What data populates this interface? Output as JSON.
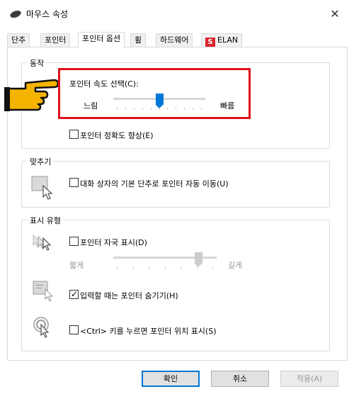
{
  "window": {
    "title": "마우스 속성",
    "close_label": "✕"
  },
  "tabs": [
    {
      "label": "단추"
    },
    {
      "label": "포인터"
    },
    {
      "label": "포인터 옵션",
      "active": true
    },
    {
      "label": "휠"
    },
    {
      "label": "하드웨어"
    },
    {
      "label": "ELAN"
    }
  ],
  "motion": {
    "group_label": "동작",
    "speed_label": "포인터 속도 선택(C):",
    "slow_label": "느림",
    "fast_label": "빠름",
    "speed_level": 0.5,
    "precision_label": "포인터 정확도 향상(E)",
    "precision_checked": false
  },
  "snap": {
    "group_label": "맞추기",
    "snap_label": "대화 상자의 기본 단추로 포인터 자동 이동(U)",
    "snap_checked": false
  },
  "visibility": {
    "group_label": "표시 유형",
    "trails_label": "포인터 자국 표시(D)",
    "trails_checked": false,
    "short_label": "짧게",
    "long_label": "길게",
    "trails_level": 0.85,
    "hide_label": "입력할 때는 포인터 숨기기(H)",
    "hide_checked": true,
    "ctrl_label": "<Ctrl> 키를 누르면 포인터 위치 표시(S)",
    "ctrl_checked": false
  },
  "buttons": {
    "ok": "확인",
    "cancel": "취소",
    "apply": "적용(A)"
  },
  "colors": {
    "accent": "#0078d7",
    "highlight": "#e0101a",
    "hand": "#f5b300"
  }
}
